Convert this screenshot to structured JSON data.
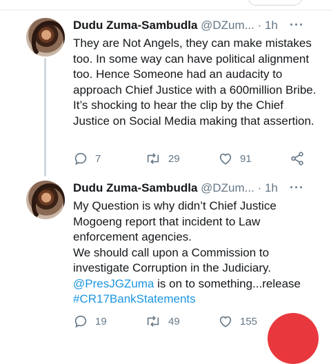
{
  "tweets": [
    {
      "name": "Dudu Zuma-Sambudla",
      "handle": "@DZum...",
      "time": "· 1h",
      "more": "···",
      "paragraphs": [
        "They are Not Angels, they can make mistakes too. In some way can have political alignment too. Hence Someone had an audacity to approach Chief Justice with a 600million Bribe. It’s shocking to hear the clip by the Chief Justice on Social Media making that assertion."
      ],
      "reply_count": "7",
      "retweet_count": "29",
      "like_count": "91"
    },
    {
      "name": "Dudu Zuma-Sambudla",
      "handle": "@DZum...",
      "time": "· 1h",
      "more": "···",
      "paragraphs": [
        "My Question is why didn’t Chief Justice Mogoeng report that incident to Law enforcement agencies.",
        "We should call upon a Commission to investigate Corruption in the Judiciary."
      ],
      "mention": "@PresJGZuma",
      "after_mention": " is on to something...release",
      "hashtag": "#CR17BankStatements",
      "reply_count": "19",
      "retweet_count": "49",
      "like_count": "155"
    }
  ],
  "icons": [
    "reply-icon",
    "retweet-icon",
    "like-icon",
    "share-icon"
  ],
  "colors": {
    "link": "#1b95e0",
    "muted": "#657786",
    "text": "#14171a",
    "fab": "#e8383d"
  }
}
